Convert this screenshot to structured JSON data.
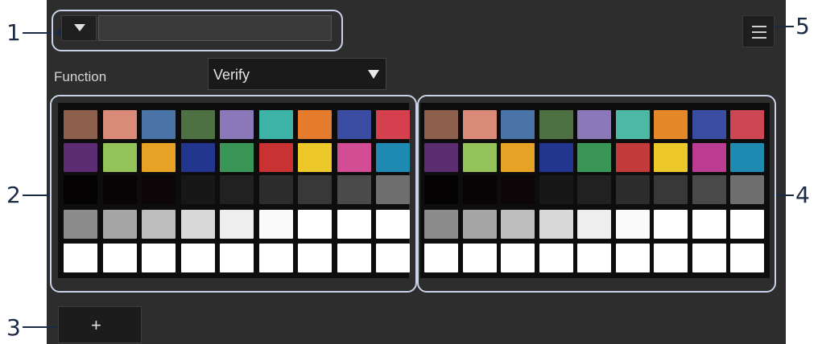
{
  "callouts": {
    "c1": "1",
    "c2": "2",
    "c3": "3",
    "c4": "4",
    "c5": "5"
  },
  "function": {
    "label": "Function",
    "value": "Verify"
  },
  "add_button": {
    "label": "+"
  },
  "icons": {
    "dropdown": "triangle-down-icon",
    "menu": "menu-icon",
    "select_arrow": "triangle-down-icon"
  },
  "left_chart": {
    "rows": [
      [
        "#8d5f4d",
        "#d98a79",
        "#4a73a8",
        "#4e7143",
        "#8a78b9",
        "#3db3a8",
        "#e57b2c",
        "#3a4da3",
        "#d4404e"
      ],
      [
        "#5d2d74",
        "#93c15a",
        "#e6a224",
        "#22358f",
        "#3a9657",
        "#c83232",
        "#edc82a",
        "#d24d93",
        "#1e89b1"
      ],
      [
        "#050203",
        "#080304",
        "#0d0608",
        "#171717",
        "#212121",
        "#2c2c2c",
        "#383838",
        "#4a4a4a",
        "#6e6e6e"
      ],
      [
        "#8c8c8c",
        "#a6a6a6",
        "#bdbdbd",
        "#d8d8d8",
        "#eeeeee",
        "#fafafa",
        "#ffffff",
        "#ffffff",
        "#ffffff"
      ],
      [
        "#ffffff",
        "#ffffff",
        "#ffffff",
        "#ffffff",
        "#ffffff",
        "#ffffff",
        "#ffffff",
        "#ffffff",
        "#ffffff"
      ]
    ]
  },
  "right_chart": {
    "rows": [
      [
        "#8d5f4d",
        "#d98a79",
        "#4a73a8",
        "#4e7143",
        "#8a78b9",
        "#4db8a3",
        "#e5882a",
        "#3a4da3",
        "#cc4653"
      ],
      [
        "#5a2e70",
        "#93c15a",
        "#e6a224",
        "#22358f",
        "#3a9657",
        "#c23a3a",
        "#edc82a",
        "#bb3c91",
        "#1e89b1"
      ],
      [
        "#050203",
        "#080304",
        "#0d0608",
        "#171717",
        "#212121",
        "#2c2c2c",
        "#383838",
        "#4a4a4a",
        "#6e6e6e"
      ],
      [
        "#8c8c8c",
        "#a6a6a6",
        "#bdbdbd",
        "#d8d8d8",
        "#eeeeee",
        "#fafafa",
        "#ffffff",
        "#ffffff",
        "#ffffff"
      ],
      [
        "#ffffff",
        "#ffffff",
        "#ffffff",
        "#ffffff",
        "#ffffff",
        "#ffffff",
        "#ffffff",
        "#ffffff",
        "#ffffff"
      ]
    ]
  }
}
